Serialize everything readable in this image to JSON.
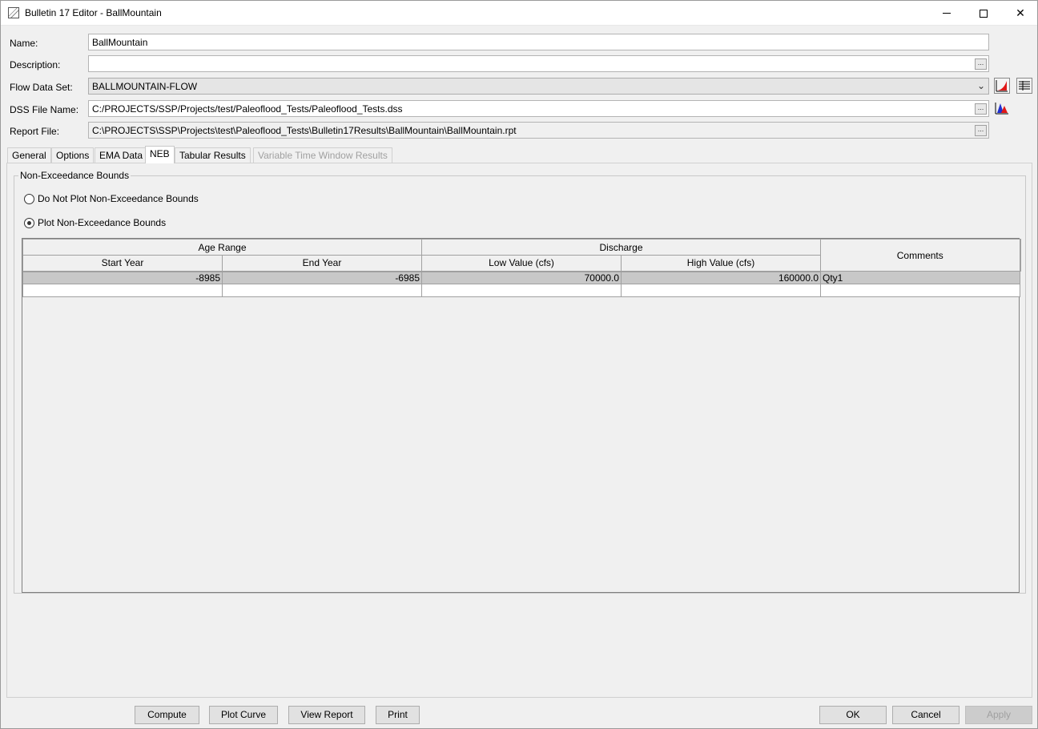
{
  "window": {
    "title": "Bulletin 17 Editor - BallMountain"
  },
  "form": {
    "name_label": "Name:",
    "name_value": "BallMountain",
    "description_label": "Description:",
    "description_value": "",
    "flow_label": "Flow Data Set:",
    "flow_value": "BALLMOUNTAIN-FLOW",
    "dss_label": "DSS File Name:",
    "dss_value": "C:/PROJECTS/SSP/Projects/test/Paleoflood_Tests/Paleoflood_Tests.dss",
    "report_label": "Report File:",
    "report_value": "C:\\PROJECTS\\SSP\\Projects\\test\\Paleoflood_Tests\\Bulletin17Results\\BallMountain\\BallMountain.rpt",
    "browse_label": "..."
  },
  "tabs": [
    {
      "label": "General"
    },
    {
      "label": "Options"
    },
    {
      "label": "EMA Data"
    },
    {
      "label": "NEB",
      "active": true
    },
    {
      "label": "Tabular Results"
    },
    {
      "label": "Variable Time Window Results",
      "disabled": true
    }
  ],
  "neb": {
    "group_title": "Non-Exceedance Bounds",
    "radio_no_plot": "Do Not Plot Non-Exceedance Bounds",
    "radio_plot": "Plot Non-Exceedance Bounds",
    "selected_option": "plot",
    "table": {
      "group_headers": [
        "Age Range",
        "Discharge"
      ],
      "comments_header": "Comments",
      "columns": [
        "Start Year",
        "End Year",
        "Low Value (cfs)",
        "High Value (cfs)"
      ],
      "rows": [
        {
          "start_year": "-8985",
          "end_year": "-6985",
          "low": "70000.0",
          "high": "160000.0",
          "comments": "Qty1"
        },
        {
          "start_year": "",
          "end_year": "",
          "low": "",
          "high": "",
          "comments": ""
        }
      ]
    }
  },
  "buttons": {
    "compute": "Compute",
    "plot_curve": "Plot Curve",
    "view_report": "View Report",
    "print": "Print",
    "ok": "OK",
    "cancel": "Cancel",
    "apply": "Apply"
  },
  "icons": {
    "app": "bulletin17-app-icon",
    "plot_flow": "plot-chart-icon",
    "table_flow": "table-icon",
    "plot_dss": "dss-plot-icon"
  }
}
